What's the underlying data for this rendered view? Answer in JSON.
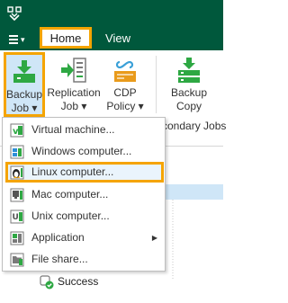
{
  "menubar": {
    "tabs": [
      {
        "label": "Home"
      },
      {
        "label": "View"
      }
    ]
  },
  "ribbon": {
    "buttons": [
      {
        "line1": "Backup",
        "line2": "Job ▾",
        "icon": "backup-job-icon"
      },
      {
        "line1": "Replication",
        "line2": "Job ▾",
        "icon": "replication-job-icon"
      },
      {
        "line1": "CDP",
        "line2": "Policy ▾",
        "icon": "cdp-policy-icon"
      },
      {
        "line1": "Backup",
        "line2": "Copy",
        "icon": "backup-copy-icon"
      }
    ],
    "group_label": "condary Jobs"
  },
  "dropdown": {
    "items": [
      {
        "label": "Virtual machine...",
        "icon": "virtual-machine-icon"
      },
      {
        "label": "Windows computer...",
        "icon": "windows-computer-icon"
      },
      {
        "label": "Linux computer...",
        "icon": "linux-computer-icon"
      },
      {
        "label": "Mac computer...",
        "icon": "mac-computer-icon"
      },
      {
        "label": "Unix computer...",
        "icon": "unix-computer-icon"
      },
      {
        "label": "Application",
        "icon": "application-icon",
        "submenu_arrow": "▶"
      },
      {
        "label": "File share...",
        "icon": "file-share-icon"
      }
    ]
  },
  "tree": {
    "status_label": "Success"
  },
  "colors": {
    "titlebar": "#00583c",
    "highlight": "#f5a400",
    "accent_green": "#2ea843",
    "selection": "#cfe6f7"
  }
}
